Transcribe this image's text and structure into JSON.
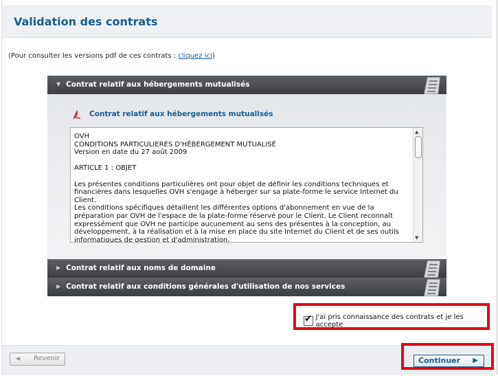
{
  "header": {
    "title": "Validation des contrats"
  },
  "intro": {
    "text": "(Pour consulter les versions pdf de ces contrats : ",
    "link": "cliquez ici",
    "suffix": ")"
  },
  "sections": [
    {
      "label": "Contrat relatif aux hébergements mutualisés",
      "expanded": true
    },
    {
      "label": "Contrat relatif aux noms de domaine",
      "expanded": false
    },
    {
      "label": "Contrat relatif aux conditions générales d'utilisation de nos services",
      "expanded": false
    }
  ],
  "content": {
    "pdf_link": "Contrat relatif aux hébergements mutualisés",
    "contract_text": "OVH\nCONDITIONS PARTICULIERES D'HÉBERGEMENT MUTUALISÉ\nVersion en date du 27 août 2009\n\nARTICLE 1 : OBJET\n\nLes présentes conditions particulières ont pour objet de définir les conditions techniques et financières dans lesquelles OVH s'engage à héberger sur sa plate-forme le service Internet du Client.\nLes conditions spécifiques détaillent les différentes options d'abonnement en vue de la préparation par OVH de l'espace de la plate-forme réservé pour le Client. Le Client reconnaît expressément que OVH ne participe aucunement au sens des présentes à la conception, au développement, à la réalisation et à la mise en place du site Internet du Client et de ses outils informatiques de gestion et d'administration."
  },
  "accept": {
    "label": "J'ai pris connaissance des contrats et je les accepte",
    "checked": true
  },
  "footer": {
    "back_label": "Revenir",
    "continue_label": "Continuer"
  },
  "colors": {
    "accent": "#1a5c91",
    "highlight": "#e30613",
    "section_header": "#46494d"
  }
}
